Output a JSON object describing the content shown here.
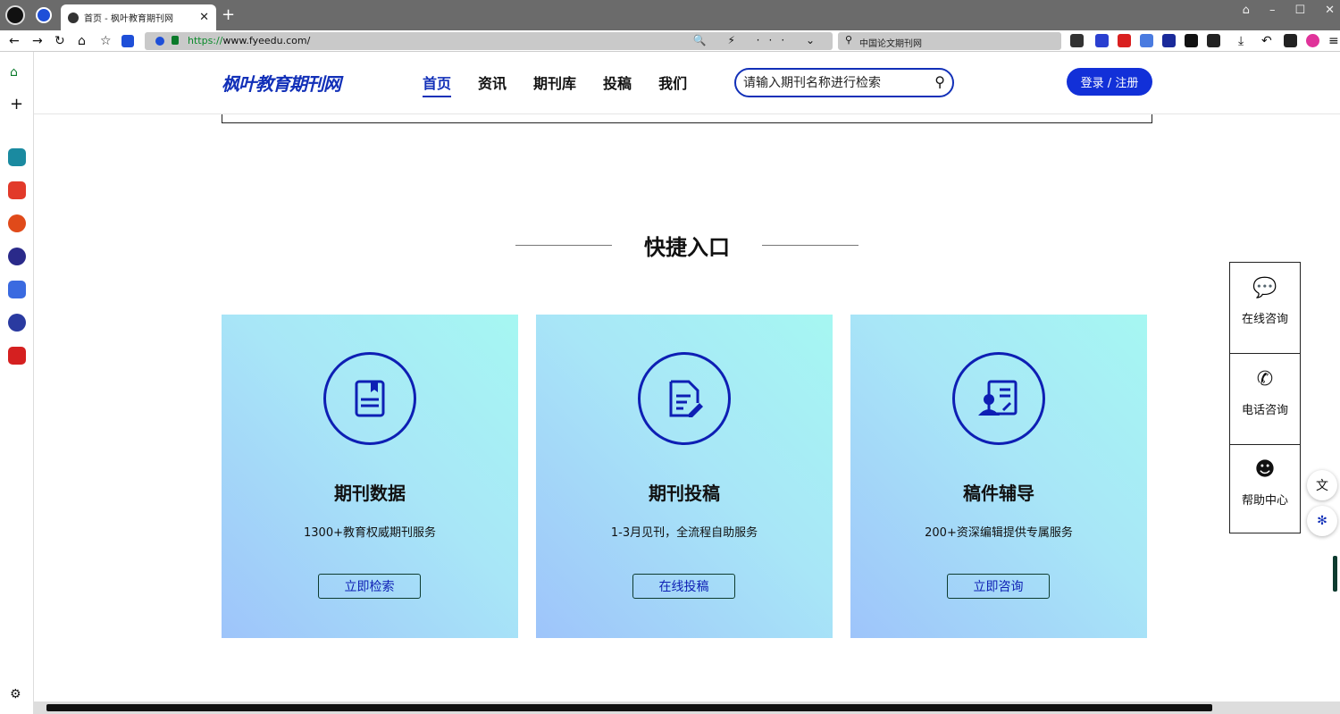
{
  "browser": {
    "tab_title": "首页 - 枫叶教育期刊网",
    "tab_close": "✕",
    "new_tab": "+",
    "url_scheme": "https://",
    "url_rest": "www.fyeedu.com/",
    "url_tools": "🔍 ⚡ ··· ⌄",
    "search_engine_text": "中国论文期刊网",
    "window_controls": [
      "⌂",
      "–",
      "☐",
      "✕"
    ],
    "nav_icons": [
      "back-arrow-icon",
      "forward-arrow-icon",
      "reload-icon",
      "home-icon",
      "bookmark-list-icon",
      "ai-icon"
    ],
    "sidebar_icons": [
      "home-icon",
      "add-icon",
      "app-icon-1",
      "app-icon-2",
      "app-icon-3",
      "app-icon-4",
      "app-icon-5",
      "app-icon-6",
      "app-icon-7",
      "settings-icon"
    ]
  },
  "site": {
    "logo": "枫叶教育期刊网",
    "menu": [
      {
        "label": "首页",
        "active": true
      },
      {
        "label": "资讯",
        "active": false
      },
      {
        "label": "期刊库",
        "active": false
      },
      {
        "label": "投稿",
        "active": false
      },
      {
        "label": "我们",
        "active": false
      }
    ],
    "search_placeholder": "请输入期刊名称进行检索",
    "login_label": "登录 / 注册"
  },
  "quick_entry": {
    "title": "快捷入口",
    "cards": [
      {
        "icon": "journal-book-icon",
        "title": "期刊数据",
        "desc": "1300+教育权威期刊服务",
        "button": "立即检索"
      },
      {
        "icon": "document-edit-icon",
        "title": "期刊投稿",
        "desc": "1-3月见刊，全流程自助服务",
        "button": "在线投稿"
      },
      {
        "icon": "editor-consult-icon",
        "title": "稿件辅导",
        "desc": "200+资深编辑提供专属服务",
        "button": "立即咨询"
      }
    ]
  },
  "float_panel": [
    {
      "icon": "chat-bubble-icon",
      "label": "在线咨询"
    },
    {
      "icon": "phone-icon",
      "label": "电话咨询"
    },
    {
      "icon": "help-icon",
      "label": "帮助中心"
    }
  ],
  "colors": {
    "brand": "#1230b8",
    "login_button": "#1230d8",
    "card_gradient_start": "#9ec4fa",
    "card_gradient_end": "#a6f7f2"
  }
}
